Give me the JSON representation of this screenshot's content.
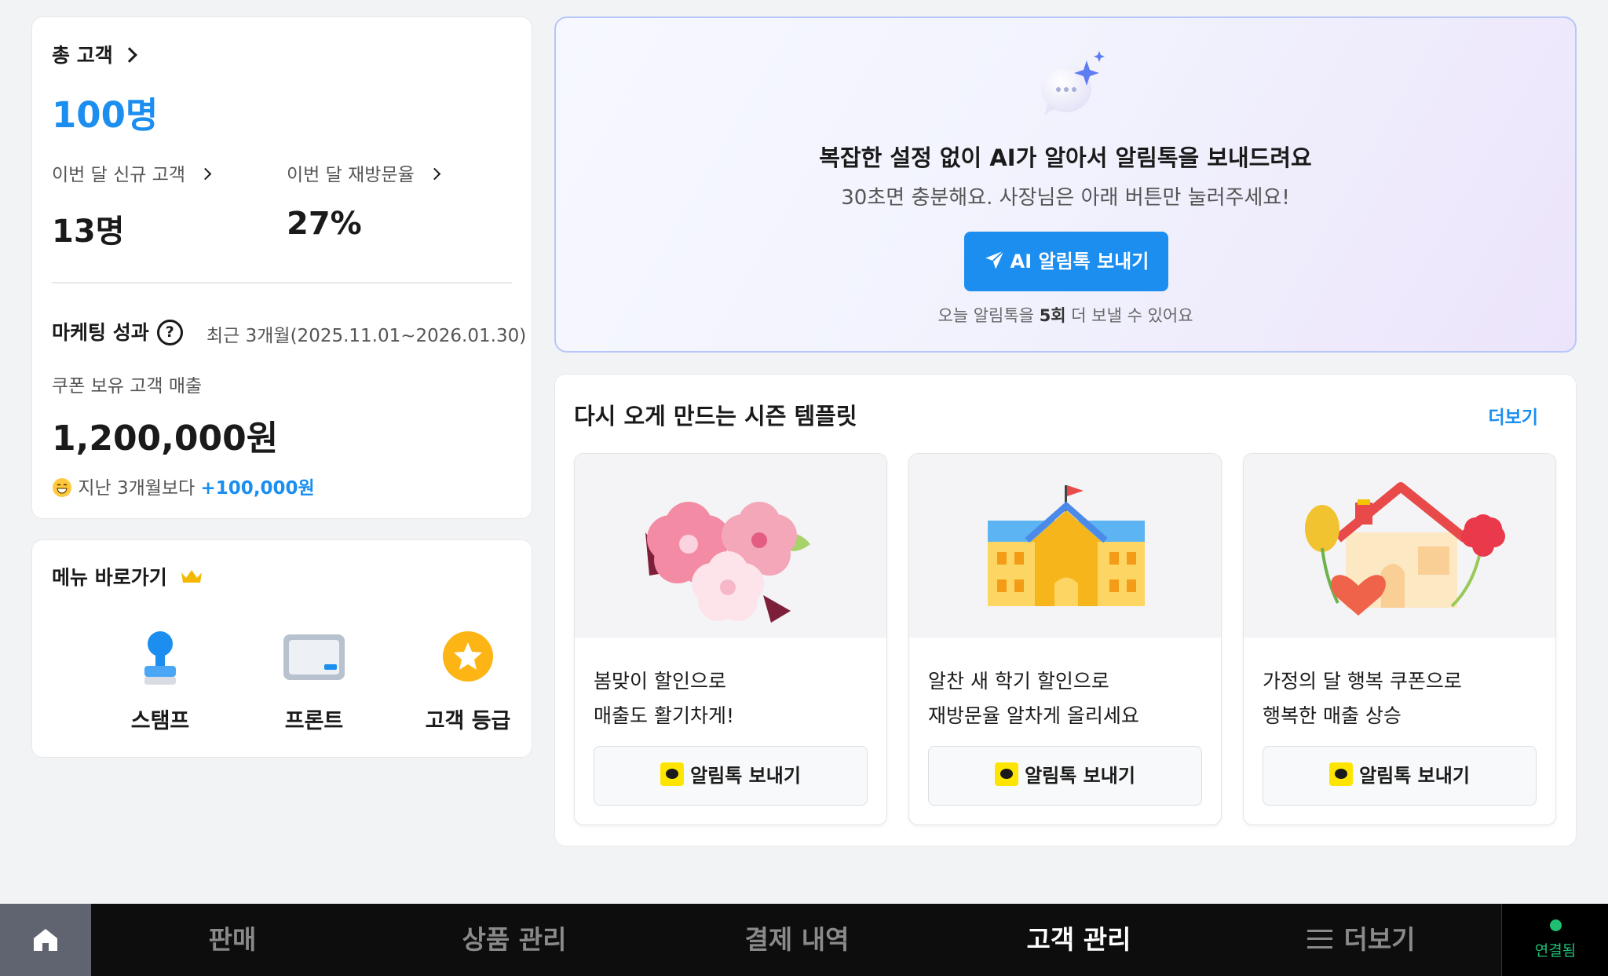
{
  "summary": {
    "total_label": "총 고객",
    "total_value": "100명",
    "new_label": "이번 달 신규 고객",
    "new_value": "13명",
    "revisit_label": "이번 달 재방문율",
    "revisit_value": "27%",
    "marketing_label": "마케팅 성과",
    "period": "최근 3개월(2025.11.01~2026.01.30)",
    "coupon_label": "쿠폰 보유 고객 매출",
    "coupon_value": "1,200,000원",
    "compare_text": "지난 3개월보다",
    "compare_delta": "+100,000원",
    "help_glyph": "?"
  },
  "menu": {
    "title": "메뉴 바로가기",
    "items": [
      {
        "label": "스탬프",
        "icon": "stamp-icon"
      },
      {
        "label": "프론트",
        "icon": "tablet-icon"
      },
      {
        "label": "고객 등급",
        "icon": "star-badge-icon"
      }
    ]
  },
  "ai_banner": {
    "title": "복잡한 설정 없이 AI가 알아서 알림톡을 보내드려요",
    "subtitle": "30초면 충분해요. 사장님은 아래 버튼만 눌러주세요!",
    "button_label": "AI 알림톡 보내기",
    "note_before": "오늘 알림톡을 ",
    "note_count": "5회",
    "note_after": " 더 보낼 수 있어요"
  },
  "season": {
    "title": "다시 오게 만드는 시즌 템플릿",
    "more_label": "더보기",
    "templates": [
      {
        "line1": "봄맞이 할인으로",
        "line2": "매출도 활기차게!",
        "button": "알림톡 보내기",
        "image": "cherry-blossom"
      },
      {
        "line1": "알찬 새 학기 할인으로",
        "line2": "재방문율 알차게 올리세요",
        "button": "알림톡 보내기",
        "image": "school-building"
      },
      {
        "line1": "가정의 달 행복 쿠폰으로",
        "line2": "행복한 매출 상승",
        "button": "알림톡 보내기",
        "image": "family-house"
      }
    ]
  },
  "nav": {
    "items": [
      "판매",
      "상품 관리",
      "결제 내역",
      "고객 관리",
      "더보기"
    ],
    "active": "고객 관리",
    "status": "연결됨"
  },
  "colors": {
    "accent": "#1b8ef0",
    "nav_bg": "#0d0d0d",
    "status_green": "#1fbf72",
    "kakao_yellow": "#fee500"
  }
}
